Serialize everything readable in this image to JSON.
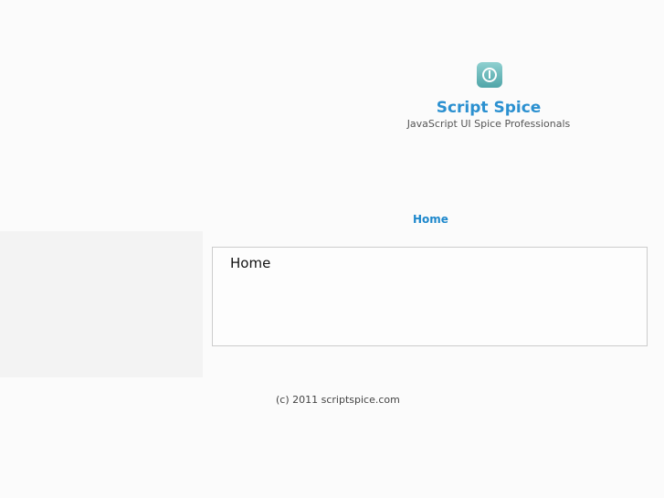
{
  "header": {
    "logo_icon": "power-icon",
    "title": "Script Spice",
    "tagline": "JavaScript UI Spice Professionals"
  },
  "nav": {
    "items": [
      {
        "label": "Home"
      }
    ]
  },
  "main": {
    "heading": "Home"
  },
  "footer": {
    "text": "(c) 2011 scriptspice.com"
  },
  "colors": {
    "accent": "#2b90d0"
  }
}
